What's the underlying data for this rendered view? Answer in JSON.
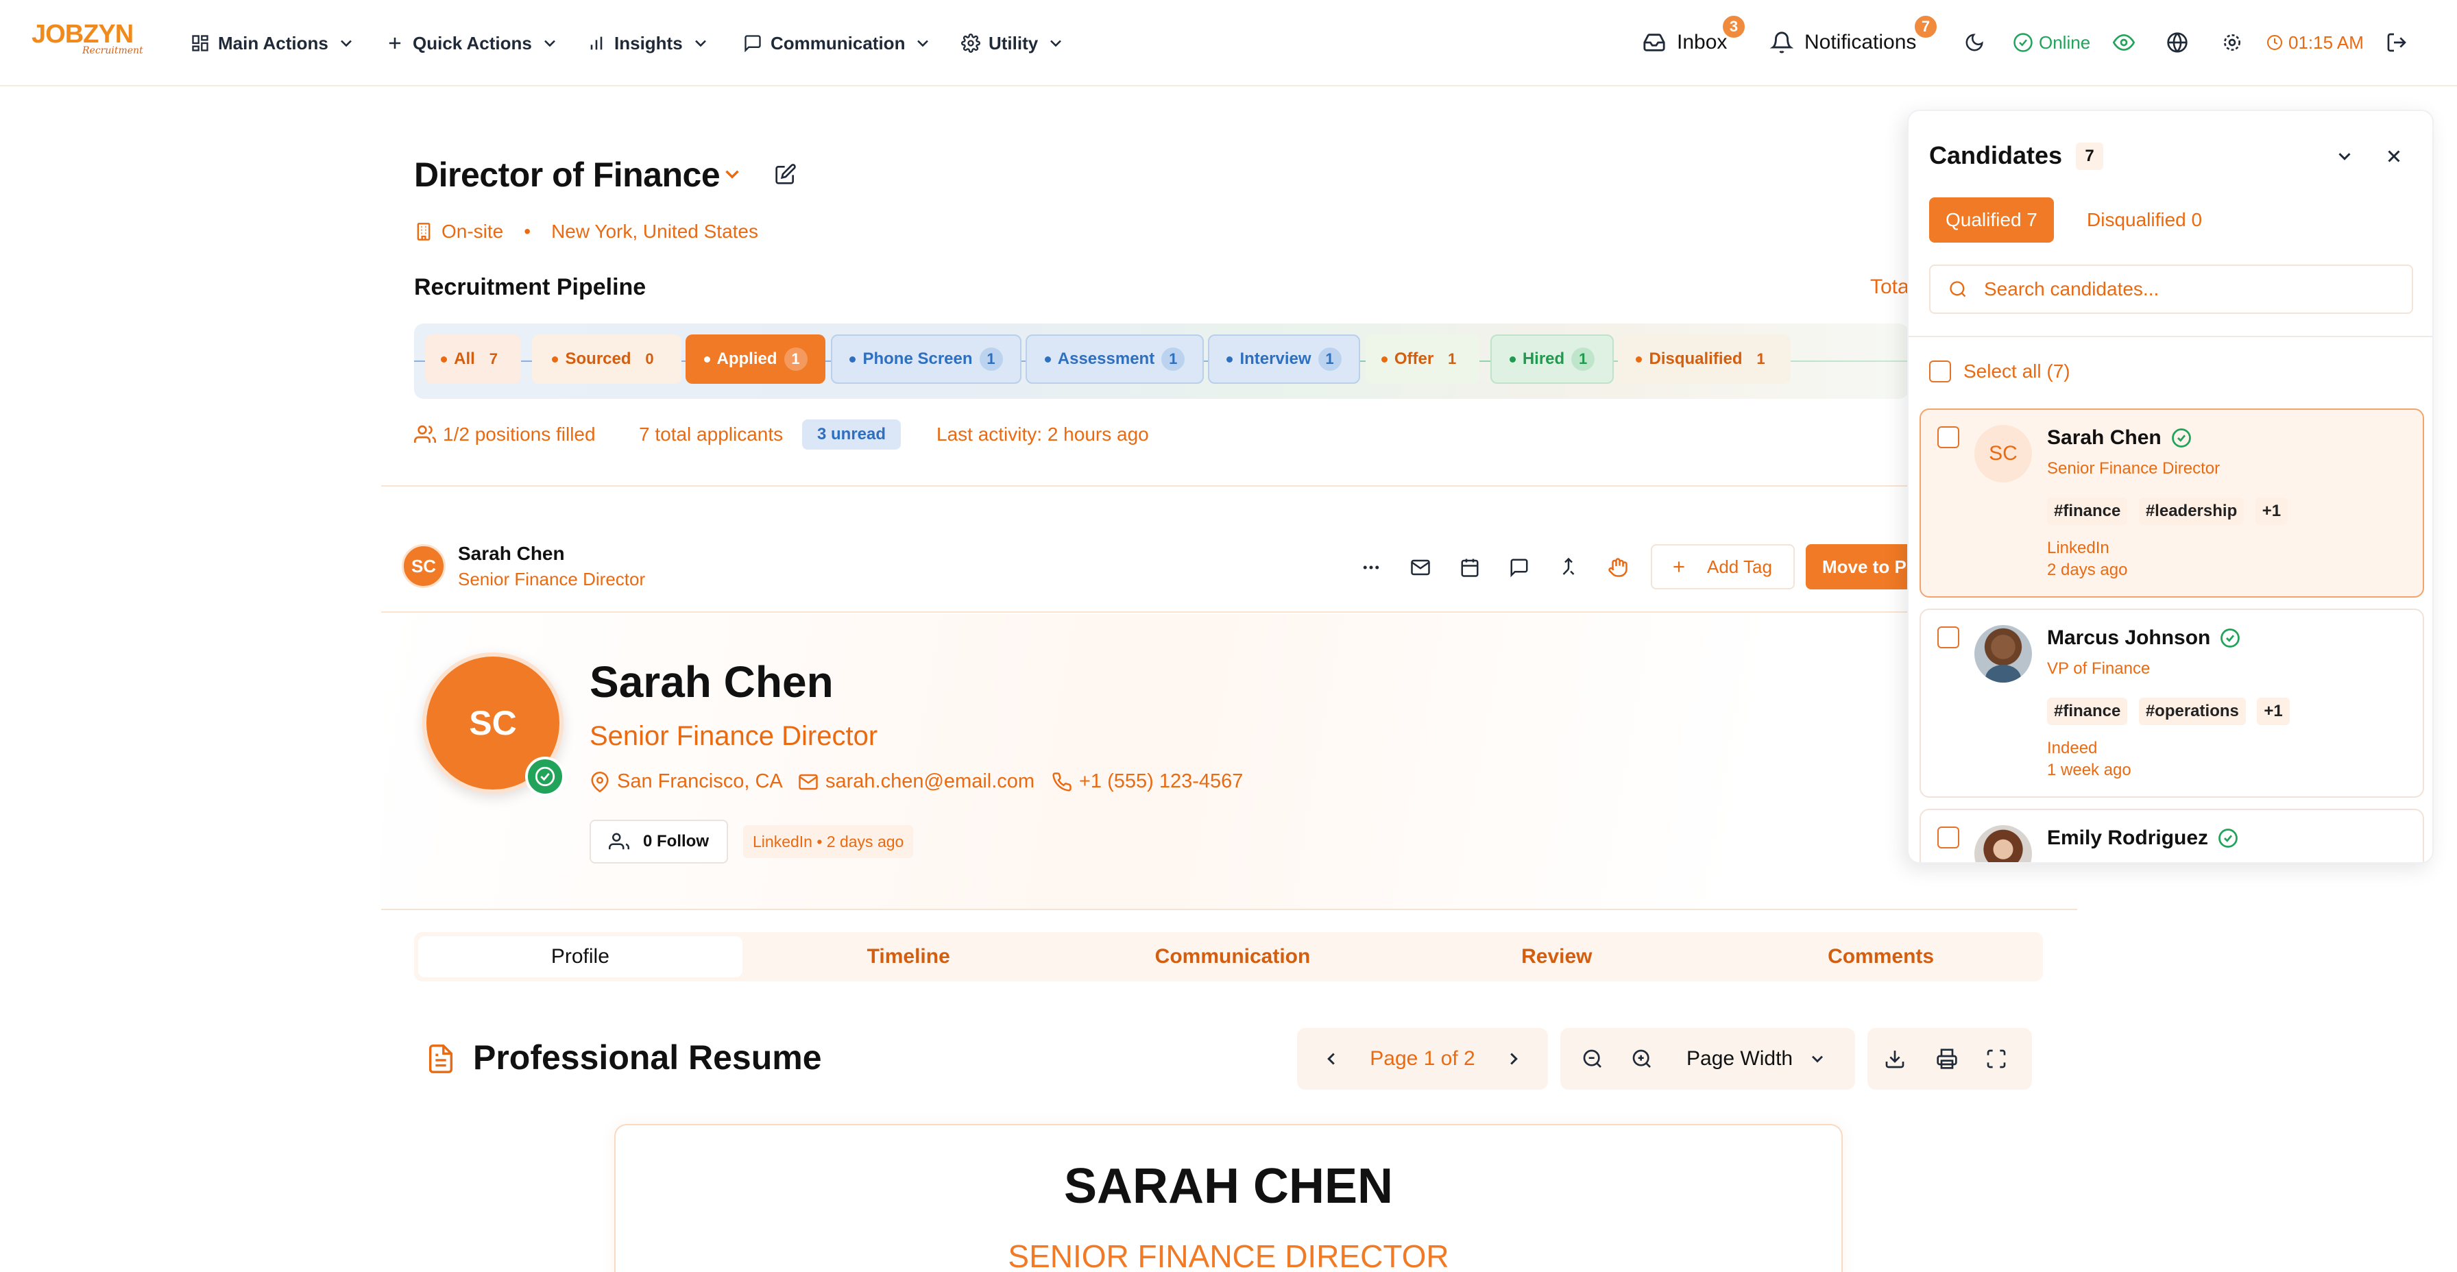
{
  "brand": {
    "logo_main": "JOBZYN",
    "logo_sub": "Recruitment"
  },
  "nav": {
    "menus": [
      "Main Actions",
      "Quick Actions",
      "Insights",
      "Communication",
      "Utility"
    ],
    "inbox_label": "Inbox",
    "inbox_count": "3",
    "notifications_label": "Notifications",
    "notifications_count": "7",
    "status": "Online",
    "time": "01:15 AM"
  },
  "job": {
    "title": "Director of Finance",
    "work_type": "On-site",
    "location": "New York, United States",
    "pipeline_heading": "Recruitment Pipeline",
    "total_label": "Tota"
  },
  "pipeline": [
    {
      "label": "All",
      "count": "7"
    },
    {
      "label": "Sourced",
      "count": "0"
    },
    {
      "label": "Applied",
      "count": "1"
    },
    {
      "label": "Phone Screen",
      "count": "1"
    },
    {
      "label": "Assessment",
      "count": "1"
    },
    {
      "label": "Interview",
      "count": "1"
    },
    {
      "label": "Offer",
      "count": "1"
    },
    {
      "label": "Hired",
      "count": "1"
    },
    {
      "label": "Disqualified",
      "count": "1"
    }
  ],
  "stats": {
    "positions": "1/2 positions filled",
    "applicants": "7 total applicants",
    "unread": "3 unread",
    "activity": "Last activity: 2 hours ago"
  },
  "candidate_bar": {
    "initials": "SC",
    "name": "Sarah Chen",
    "role": "Senior Finance Director",
    "add_tag": "Add Tag",
    "move_button": "Move to Ph"
  },
  "profile": {
    "initials": "SC",
    "name": "Sarah Chen",
    "role": "Senior Finance Director",
    "location": "San Francisco, CA",
    "email": "sarah.chen@email.com",
    "phone": "+1 (555) 123-4567",
    "follow": "0 Follow",
    "source": "LinkedIn • 2 days ago"
  },
  "tabs": [
    "Profile",
    "Timeline",
    "Communication",
    "Review",
    "Comments"
  ],
  "resume": {
    "heading": "Professional Resume",
    "page": "Page 1 of 2",
    "zoom": "Page Width",
    "doc_name": "SARAH CHEN",
    "doc_title": "SENIOR FINANCE DIRECTOR"
  },
  "panel": {
    "title": "Candidates",
    "count": "7",
    "qualified": "Qualified 7",
    "disqualified": "Disqualified 0",
    "search_placeholder": "Search candidates...",
    "select_all": "Select all (7)",
    "cards": [
      {
        "initials": "SC",
        "name": "Sarah Chen",
        "role": "Senior Finance Director",
        "tags": [
          "#finance",
          "#leadership",
          "+1"
        ],
        "source": "LinkedIn",
        "time": "2 days ago"
      },
      {
        "name": "Marcus Johnson",
        "role": "VP of Finance",
        "tags": [
          "#finance",
          "#operations",
          "+1"
        ],
        "source": "Indeed",
        "time": "1 week ago"
      },
      {
        "name": "Emily Rodriguez"
      }
    ]
  },
  "colors": {
    "accent": "#ea6a12",
    "success": "#22a35a",
    "info_blue": "#2f6fbf"
  }
}
